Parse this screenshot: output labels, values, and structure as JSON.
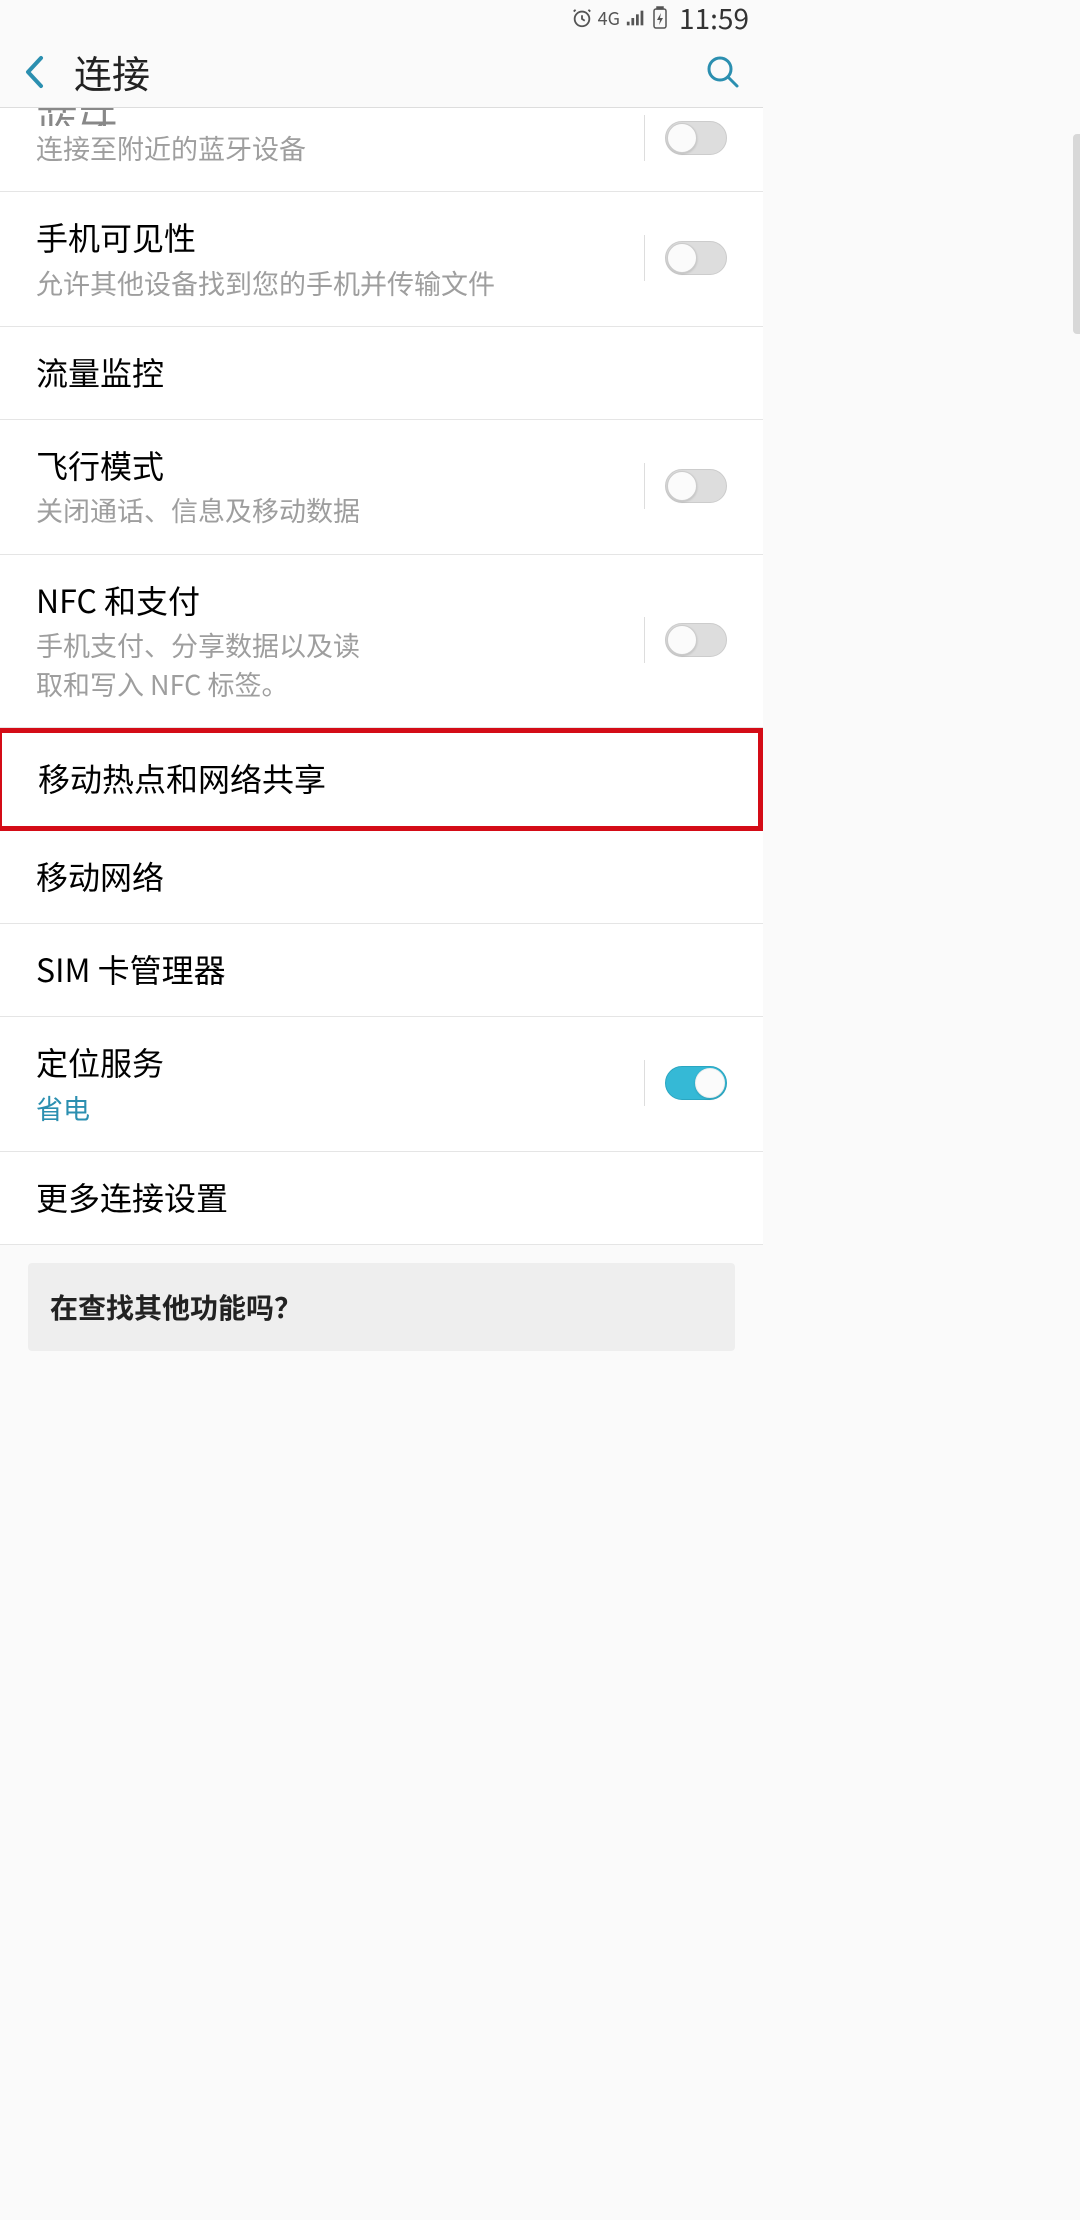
{
  "status": {
    "network_label": "4G",
    "time": "11:59"
  },
  "header": {
    "title": "连接"
  },
  "items": [
    {
      "title": "蓝牙",
      "sub": "连接至附近的蓝牙设备",
      "toggle": true,
      "on": false,
      "partial": true
    },
    {
      "title": "手机可见性",
      "sub": "允许其他设备找到您的手机并传输文件",
      "toggle": true,
      "on": false
    },
    {
      "title": "流量监控",
      "sub": "",
      "toggle": false
    },
    {
      "title": "飞行模式",
      "sub": "关闭通话、信息及移动数据",
      "toggle": true,
      "on": false
    },
    {
      "title": "NFC 和支付",
      "sub": "手机支付、分享数据以及读取和写入 NFC 标签。",
      "toggle": true,
      "on": false,
      "sub_max": 340
    },
    {
      "title": "移动热点和网络共享",
      "sub": "",
      "toggle": false,
      "highlighted": true
    },
    {
      "title": "移动网络",
      "sub": "",
      "toggle": false
    },
    {
      "title": "SIM 卡管理器",
      "sub": "",
      "toggle": false
    },
    {
      "title": "定位服务",
      "sub": "省电",
      "sub_link": true,
      "toggle": true,
      "on": true
    },
    {
      "title": "更多连接设置",
      "sub": "",
      "toggle": false
    }
  ],
  "footer": {
    "prompt": "在查找其他功能吗？"
  }
}
